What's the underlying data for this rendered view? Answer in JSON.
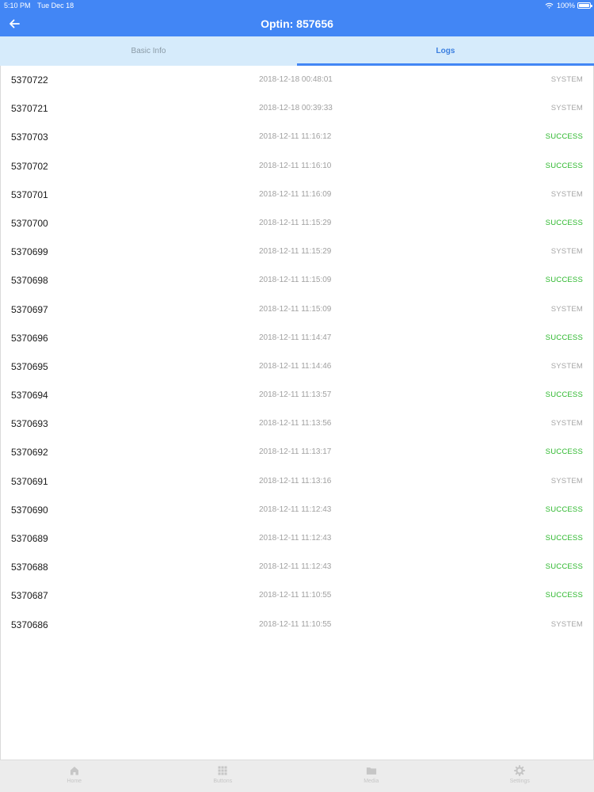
{
  "status_bar": {
    "time": "5:10 PM",
    "date": "Tue Dec 18",
    "battery": "100%"
  },
  "nav": {
    "title": "Optin: 857656",
    "back_icon": "arrow-left-icon"
  },
  "tabs": [
    {
      "label": "Basic Info",
      "active": false
    },
    {
      "label": "Logs",
      "active": true
    }
  ],
  "colors": {
    "primary": "#4286f5",
    "tab_bg": "#d6ebfb",
    "success": "#2db82d",
    "system": "#a6a6a6"
  },
  "logs": [
    {
      "id": "5370722",
      "timestamp": "2018-12-18 00:48:01",
      "status": "SYSTEM"
    },
    {
      "id": "5370721",
      "timestamp": "2018-12-18 00:39:33",
      "status": "SYSTEM"
    },
    {
      "id": "5370703",
      "timestamp": "2018-12-11 11:16:12",
      "status": "SUCCESS"
    },
    {
      "id": "5370702",
      "timestamp": "2018-12-11 11:16:10",
      "status": "SUCCESS"
    },
    {
      "id": "5370701",
      "timestamp": "2018-12-11 11:16:09",
      "status": "SYSTEM"
    },
    {
      "id": "5370700",
      "timestamp": "2018-12-11 11:15:29",
      "status": "SUCCESS"
    },
    {
      "id": "5370699",
      "timestamp": "2018-12-11 11:15:29",
      "status": "SYSTEM"
    },
    {
      "id": "5370698",
      "timestamp": "2018-12-11 11:15:09",
      "status": "SUCCESS"
    },
    {
      "id": "5370697",
      "timestamp": "2018-12-11 11:15:09",
      "status": "SYSTEM"
    },
    {
      "id": "5370696",
      "timestamp": "2018-12-11 11:14:47",
      "status": "SUCCESS"
    },
    {
      "id": "5370695",
      "timestamp": "2018-12-11 11:14:46",
      "status": "SYSTEM"
    },
    {
      "id": "5370694",
      "timestamp": "2018-12-11 11:13:57",
      "status": "SUCCESS"
    },
    {
      "id": "5370693",
      "timestamp": "2018-12-11 11:13:56",
      "status": "SYSTEM"
    },
    {
      "id": "5370692",
      "timestamp": "2018-12-11 11:13:17",
      "status": "SUCCESS"
    },
    {
      "id": "5370691",
      "timestamp": "2018-12-11 11:13:16",
      "status": "SYSTEM"
    },
    {
      "id": "5370690",
      "timestamp": "2018-12-11 11:12:43",
      "status": "SUCCESS"
    },
    {
      "id": "5370689",
      "timestamp": "2018-12-11 11:12:43",
      "status": "SUCCESS"
    },
    {
      "id": "5370688",
      "timestamp": "2018-12-11 11:12:43",
      "status": "SUCCESS"
    },
    {
      "id": "5370687",
      "timestamp": "2018-12-11 11:10:55",
      "status": "SUCCESS"
    },
    {
      "id": "5370686",
      "timestamp": "2018-12-11 11:10:55",
      "status": "SYSTEM"
    }
  ],
  "tab_bar": [
    {
      "label": "Home",
      "icon": "home-icon"
    },
    {
      "label": "Buttons",
      "icon": "grid-icon"
    },
    {
      "label": "Media",
      "icon": "folder-icon"
    },
    {
      "label": "Settings",
      "icon": "gear-icon"
    }
  ]
}
